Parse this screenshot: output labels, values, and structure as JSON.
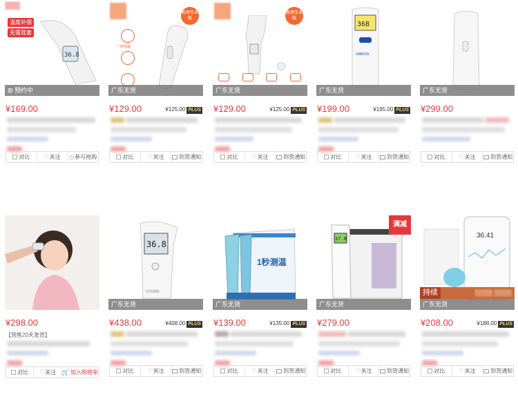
{
  "products": [
    {
      "price": "¥169.00",
      "strip": "预约中",
      "plus": "",
      "note": "",
      "actions": [
        "对比",
        "关注",
        "参与抢购"
      ],
      "tags": [
        "温度补偿",
        "无需耳套"
      ],
      "badge": "",
      "extra": ""
    },
    {
      "price": "¥129.00",
      "strip": "广东无货",
      "plus": "¥125.00",
      "note": "",
      "actions": [
        "对比",
        "关注",
        "到货通知"
      ],
      "tags": [],
      "badge": "新用专业版",
      "extra": "一秒测温"
    },
    {
      "price": "¥129.00",
      "strip": "广东无货",
      "plus": "¥125.00",
      "note": "",
      "actions": [
        "对比",
        "关注",
        "到货通知"
      ],
      "tags": [],
      "badge": "新用专业版",
      "extra": ""
    },
    {
      "price": "¥199.00",
      "strip": "广东无货",
      "plus": "¥195.00",
      "note": "",
      "actions": [
        "对比",
        "关注",
        "到货通知"
      ],
      "tags": [],
      "badge": "",
      "extra": "OMRON"
    },
    {
      "price": "¥299.00",
      "strip": "广东无货",
      "plus": "",
      "note": "",
      "actions": [
        "对比",
        "关注",
        "到货通知"
      ],
      "tags": [],
      "badge": "",
      "extra": ""
    },
    {
      "price": "¥298.00",
      "strip": "",
      "plus": "",
      "note": "【预售20天发货】",
      "actions": [
        "对比",
        "关注",
        "加入购物车"
      ],
      "tags": [],
      "badge": "",
      "extra": ""
    },
    {
      "price": "¥438.00",
      "strip": "广东无货",
      "plus": "¥408.00",
      "note": "",
      "actions": [
        "对比",
        "关注",
        "到货通知"
      ],
      "tags": [],
      "badge": "",
      "extra": "CITIZEN"
    },
    {
      "price": "¥139.00",
      "strip": "广东无货",
      "plus": "¥135.00",
      "note": "",
      "actions": [
        "对比",
        "关注",
        "到货通知"
      ],
      "tags": [],
      "badge": "",
      "extra": "1秒测温"
    },
    {
      "price": "¥279.00",
      "strip": "广东无货",
      "plus": "",
      "note": "",
      "actions": [
        "对比",
        "关注",
        "到货通知"
      ],
      "tags": [],
      "badge": "",
      "extra": "满减"
    },
    {
      "price": "¥208.00",
      "strip": "广东无货",
      "plus": "¥188.00",
      "note": "",
      "actions": [
        "对比",
        "关注",
        "到货通知"
      ],
      "tags": [],
      "badge": "持续",
      "extra": "36.41"
    }
  ],
  "plus_label": "PLUS",
  "display": {
    "p0": "36.8",
    "p6": "36.8",
    "p8": "37.0"
  },
  "colors": {
    "price": "#e4393c",
    "strip": "#6e6e6e",
    "accent": "#f26a31"
  }
}
